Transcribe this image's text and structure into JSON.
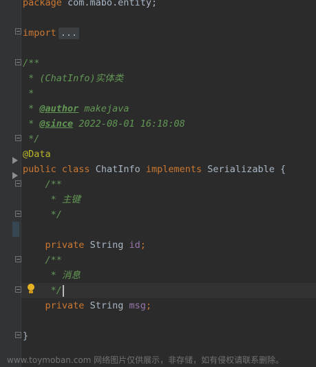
{
  "editor": {
    "line_package": {
      "keyword": "package",
      "rest": " com.mabo.entity;"
    },
    "line_import": {
      "keyword": "import",
      "folded": "..."
    },
    "line_doc_open": "/**",
    "line_doc_desc": " * (ChatInfo)实体类",
    "line_doc_blank": " *",
    "line_doc_author": {
      "prefix": " * ",
      "tag": "@author",
      "value": " makejava"
    },
    "line_doc_since": {
      "prefix": " * ",
      "tag": "@since",
      "value": " 2022-08-01 16:18:08"
    },
    "line_doc_close": " */",
    "line_annotation": "@Data",
    "line_class": {
      "modifier": "public",
      "kw_class": "class",
      "name": "ChatInfo",
      "kw_implements": "implements",
      "iface": "Serializable",
      "brace": "{"
    },
    "field_id_doc": {
      "open": "/**",
      "text": " * 主键",
      "close": " */"
    },
    "field_id": {
      "modifier": "private",
      "type": "String",
      "name": "id",
      "semi": ";"
    },
    "field_msg_doc": {
      "open": "/**",
      "text": " * 消息",
      "close": " */"
    },
    "field_msg": {
      "modifier": "private",
      "type": "String",
      "name": "msg",
      "semi": ";"
    },
    "closing_brace": "}"
  },
  "icons": {
    "fold": "fold-minus-icon",
    "implementation": "implementation-arrow-icon",
    "intention": "lightbulb-icon"
  },
  "colors": {
    "background": "#2b2b2b",
    "keyword": "#cc7832",
    "comment": "#629755",
    "annotation": "#bbb529",
    "field": "#9876aa",
    "text": "#a9b7c6"
  },
  "watermark": "www.toymoban.com 网络图片仅供展示，非存储，如有侵权请联系删除。"
}
